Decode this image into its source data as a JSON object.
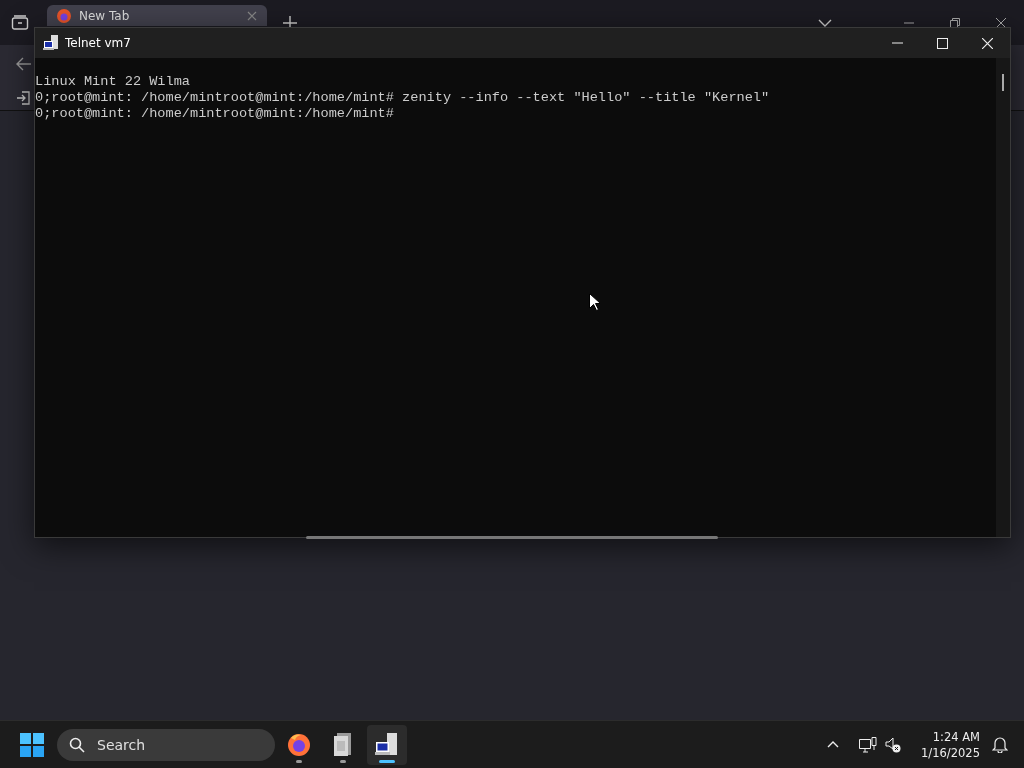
{
  "browser": {
    "tabs": [
      {
        "label": "New Tab",
        "selected": true
      }
    ]
  },
  "telnet": {
    "title": "Telnet vm7",
    "lines": [
      "Linux Mint 22 Wilma",
      "0;root@mint: /home/mintroot@mint:/home/mint# zenity --info --text \"Hello\" --title \"Kernel\"",
      "0;root@mint: /home/mintroot@mint:/home/mint#"
    ]
  },
  "taskbar": {
    "search": {
      "placeholder": "Search"
    },
    "apps": [
      {
        "kind": "firefox",
        "selected": false
      },
      {
        "kind": "files",
        "selected": false
      },
      {
        "kind": "telnet",
        "selected": true
      }
    ],
    "time": "1:24 AM",
    "date": "1/16/2025"
  }
}
